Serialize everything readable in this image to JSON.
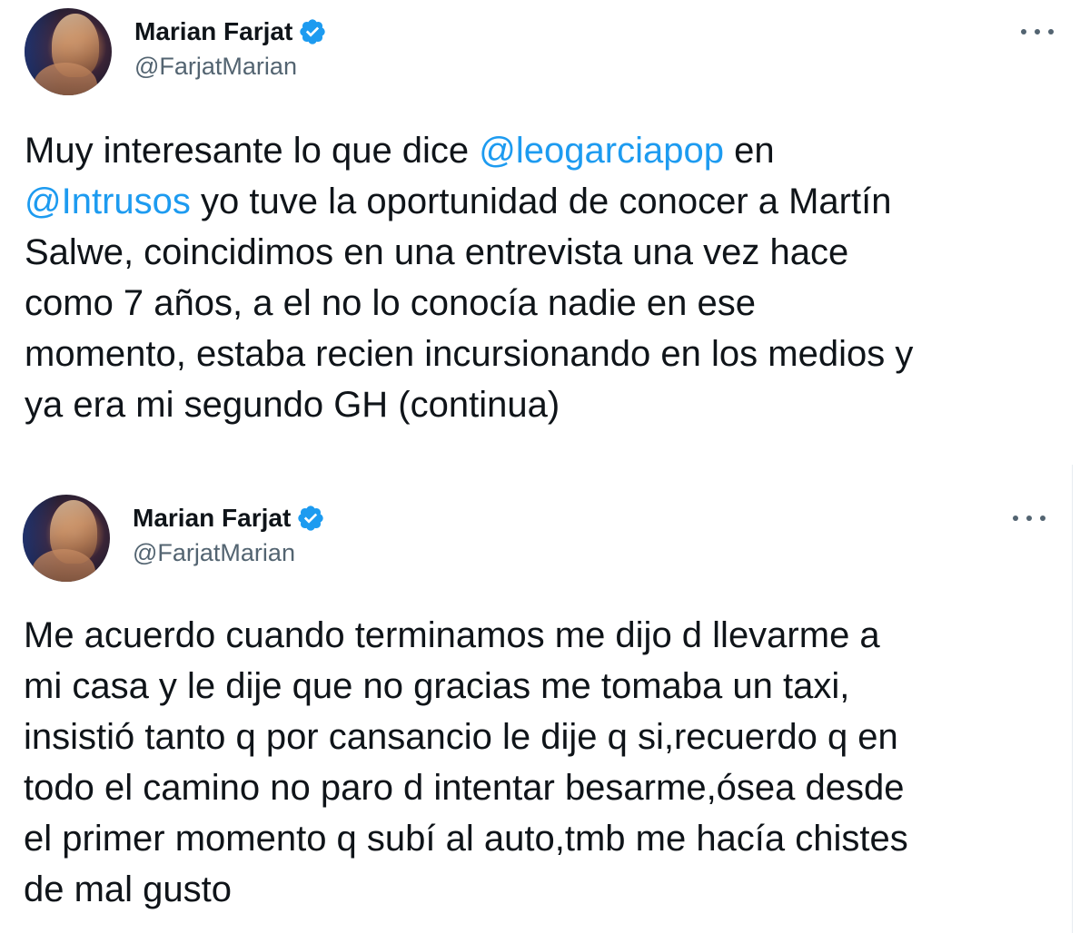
{
  "tweets": [
    {
      "author": {
        "display_name": "Marian Farjat",
        "handle": "@FarjatMarian",
        "verified": true,
        "avatar_icon": "profile-photo"
      },
      "more_icon": "more-horizontal-icon",
      "body_lines": [
        [
          {
            "text": "Muy interesante lo que dice ",
            "type": "text"
          },
          {
            "text": "@leogarciapop",
            "type": "mention"
          },
          {
            "text": " en",
            "type": "text"
          }
        ],
        [
          {
            "text": "@Intrusos",
            "type": "mention"
          },
          {
            "text": " yo tuve la oportunidad de conocer a Martín",
            "type": "text"
          }
        ],
        [
          {
            "text": "Salwe, coincidimos en una entrevista una vez hace",
            "type": "text"
          }
        ],
        [
          {
            "text": "como 7 años, a el no lo conocía nadie en ese",
            "type": "text"
          }
        ],
        [
          {
            "text": "momento, estaba recien incursionando en los medios y",
            "type": "text"
          }
        ],
        [
          {
            "text": "ya era mi segundo GH (continua)",
            "type": "text"
          }
        ]
      ]
    },
    {
      "author": {
        "display_name": "Marian Farjat",
        "handle": "@FarjatMarian",
        "verified": true,
        "avatar_icon": "profile-photo"
      },
      "more_icon": "more-horizontal-icon",
      "body_lines": [
        [
          {
            "text": "Me acuerdo cuando terminamos me dijo d llevarme a",
            "type": "text"
          }
        ],
        [
          {
            "text": "mi casa y le dije que no gracias me tomaba un taxi,",
            "type": "text"
          }
        ],
        [
          {
            "text": "insistió tanto q por cansancio le dije q si,recuerdo q en",
            "type": "text"
          }
        ],
        [
          {
            "text": "todo el camino no paro d intentar besarme,ósea desde",
            "type": "text"
          }
        ],
        [
          {
            "text": "el primer momento q subí al auto,tmb me hacía chistes",
            "type": "text"
          }
        ],
        [
          {
            "text": "de mal gusto",
            "type": "text"
          }
        ]
      ]
    }
  ],
  "colors": {
    "text": "#0f1419",
    "secondary_text": "#536471",
    "mention": "#1d9bf0",
    "verified_badge": "#1d9bf0",
    "background": "#ffffff"
  }
}
